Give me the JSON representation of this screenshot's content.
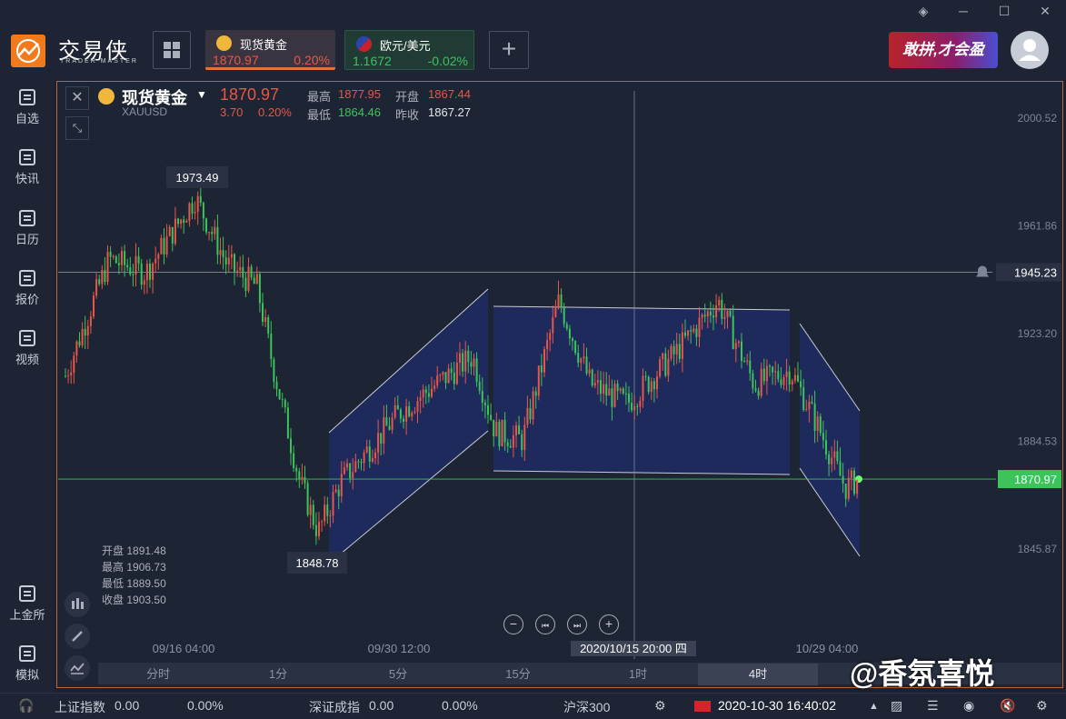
{
  "app": {
    "logo_text": "交易侠",
    "logo_sub": "TRADER MASTER",
    "banner_text": "敢拼,才会盈"
  },
  "tickers": [
    {
      "name": "现货黄金",
      "price": "1870.97",
      "change": "0.20%",
      "color": "#e8564a"
    },
    {
      "name": "欧元/美元",
      "price": "1.1672",
      "change": "-0.02%",
      "color": "#3cc45a"
    }
  ],
  "sidebar": {
    "items": [
      {
        "label": "自选",
        "icon": "bookmark-plus-icon"
      },
      {
        "label": "快讯",
        "icon": "news-icon"
      },
      {
        "label": "日历",
        "icon": "calendar-icon"
      },
      {
        "label": "报价",
        "icon": "chart-line-icon"
      },
      {
        "label": "视频",
        "icon": "video-play-icon"
      }
    ],
    "bottom_items": [
      {
        "label": "上金所",
        "icon": "exchange-icon"
      },
      {
        "label": "模拟",
        "icon": "wallet-icon"
      }
    ]
  },
  "chart_header": {
    "symbol_name": "现货黄金",
    "symbol_code": "XAUUSD",
    "price": "1870.97",
    "change": "3.70",
    "change_pct": "0.20%",
    "high_label": "最高",
    "high": "1877.95",
    "open_label": "开盘",
    "open": "1867.44",
    "low_label": "最低",
    "low": "1864.46",
    "prev_close_label": "昨收",
    "prev_close": "1867.27"
  },
  "chart_data": {
    "type": "candlestick",
    "symbol": "XAUUSD",
    "y_ticks": [
      2000.52,
      1961.86,
      1923.2,
      1884.53,
      1845.87
    ],
    "ylim": [
      1833,
      2012
    ],
    "x_ticks": [
      "09/16 04:00",
      "09/30 12:00",
      "2020/10/15 20:00 四",
      "10/29 04:00"
    ],
    "annotations": {
      "high_marker": 1973.49,
      "low_marker": 1848.78,
      "alert_line": 1945.23,
      "current_price": 1870.97
    },
    "channels": [
      "ascending",
      "horizontal",
      "descending"
    ],
    "ohlc_tooltip": {
      "open_label": "开盘",
      "open": "1891.48",
      "high_label": "最高",
      "high": "1906.73",
      "low_label": "最低",
      "low": "1889.50",
      "close_label": "收盘",
      "close": "1903.50"
    },
    "up_color": "#e8564a",
    "down_color": "#3cc45a"
  },
  "timeframes": [
    "分时",
    "1分",
    "5分",
    "15分",
    "1时",
    "4时"
  ],
  "active_timeframe": "4时",
  "watermark": "@香氛喜悦",
  "statusbar": {
    "sh_label": "上证指数",
    "sh_value": "0.00",
    "sh_pct": "0.00%",
    "sz_label": "深证成指",
    "sz_value": "0.00",
    "sz_pct": "0.00%",
    "hs_label": "沪深300",
    "datetime": "2020-10-30 16:40:02"
  }
}
